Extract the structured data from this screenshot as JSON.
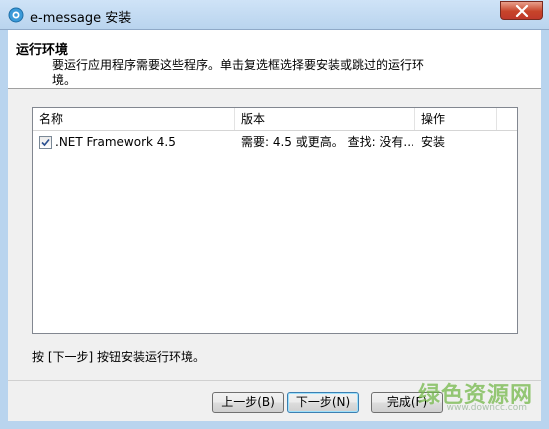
{
  "window": {
    "title": "e-message 安装"
  },
  "header": {
    "title": "运行环境",
    "subtitle": "要运行应用程序需要这些程序。单击复选框选择要安装或跳过的运行环境。"
  },
  "list": {
    "columns": [
      "名称",
      "版本",
      "操作"
    ],
    "rows": [
      {
        "checked": true,
        "name": ".NET Framework 4.5",
        "version": "需要: 4.5 或更高。 查找: 没有...",
        "action": "安装"
      }
    ]
  },
  "instruction": "按 [下一步] 按钮安装运行环境。",
  "buttons": {
    "back": "上一步(B)",
    "next": "下一步(N)",
    "finish": "完成(F)"
  },
  "watermark": {
    "text": "绿色资源网",
    "url": "www.downcc.com"
  },
  "colors": {
    "titlebar": "#b9d4ee",
    "close": "#c7442a",
    "watermark": "#74b84a"
  }
}
